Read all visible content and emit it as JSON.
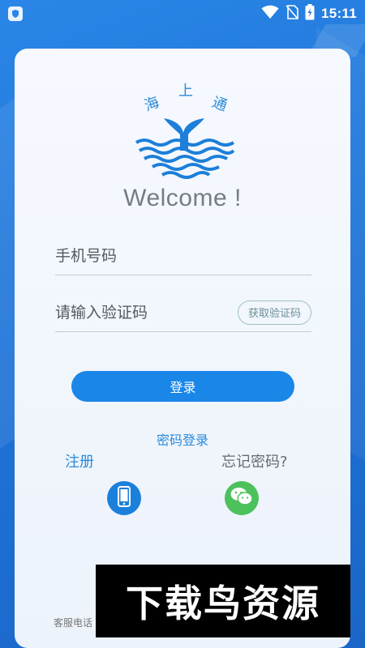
{
  "status_bar": {
    "time": "15:11",
    "icons": [
      "shield-icon",
      "wifi-icon",
      "no-sim-icon",
      "battery-charging-icon"
    ]
  },
  "logo": {
    "chars": [
      "海",
      "上",
      "通"
    ],
    "icon": "whale-tail-waves-logo",
    "color": "#2a8ad8"
  },
  "welcome": "Welcome !",
  "form": {
    "phone_placeholder": "手机号码",
    "code_placeholder": "请输入验证码",
    "get_code_label": "获取验证码"
  },
  "login_label": "登录",
  "password_login_label": "密码登录",
  "register_label": "注册",
  "forgot_label": "忘记密码?",
  "alt_login_icons": [
    "phone-icon",
    "wechat-icon"
  ],
  "service_text": "客服电话",
  "watermark": "下载鸟资源",
  "colors": {
    "background": "#1f74d8",
    "primary": "#1a86e8",
    "link": "#2a8ad8",
    "wechat": "#4cc15c"
  }
}
